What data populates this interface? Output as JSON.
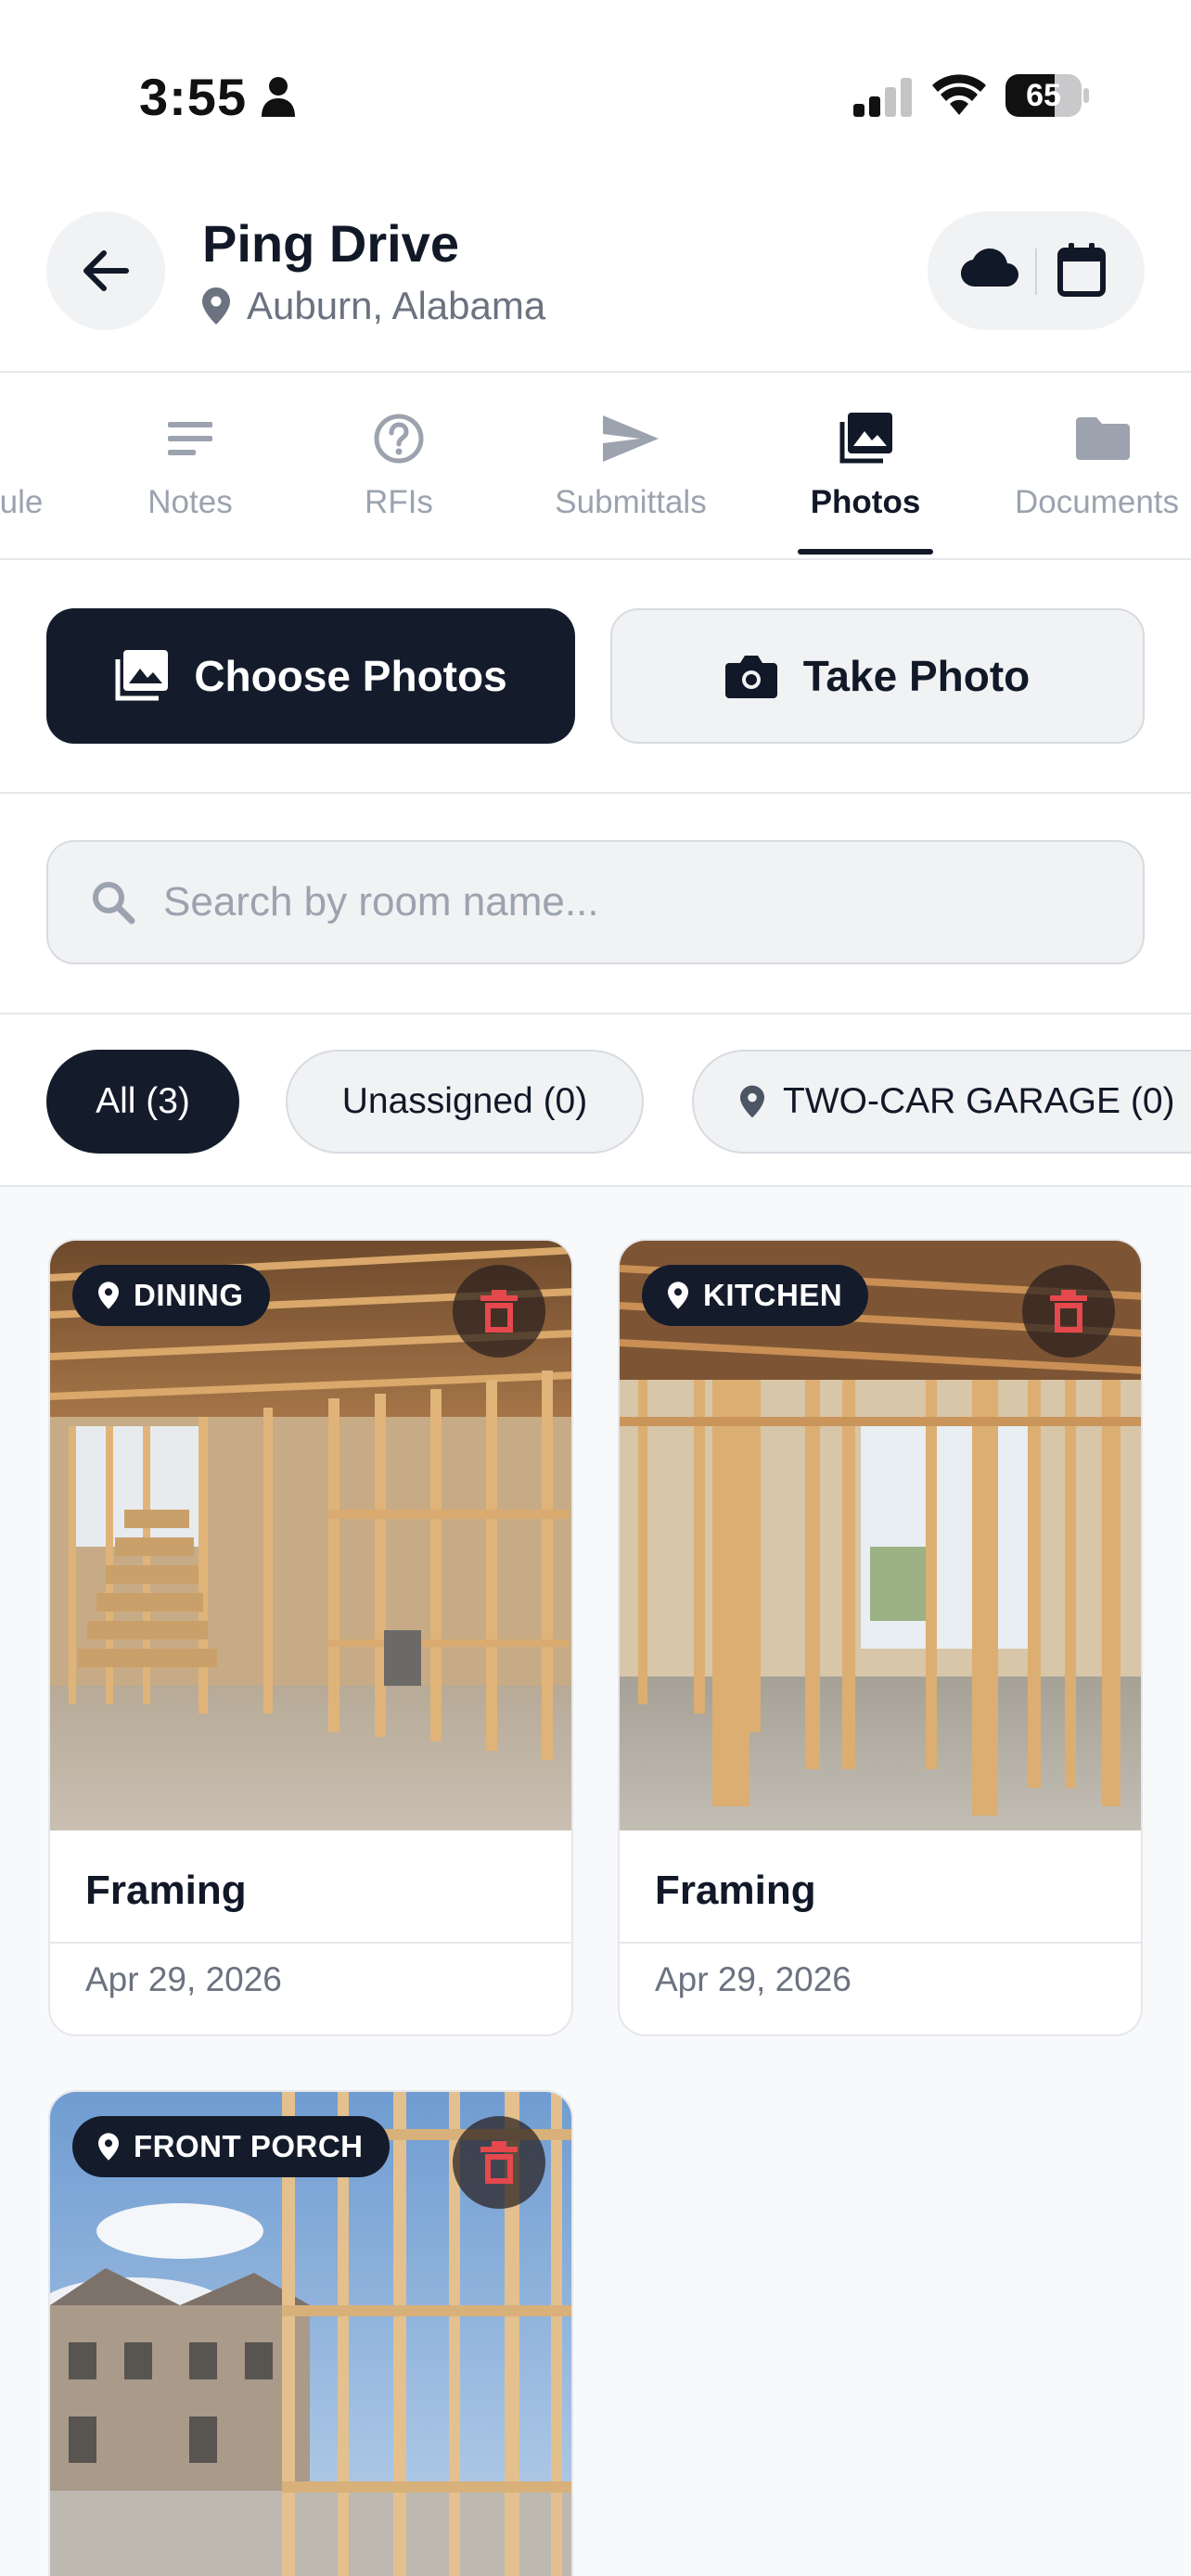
{
  "status_bar": {
    "time": "3:55",
    "battery": "65",
    "battery_level": 0.65
  },
  "header": {
    "title": "Ping Drive",
    "location": "Auburn, Alabama"
  },
  "tabs": [
    {
      "label": "ule",
      "icon": "schedule-icon"
    },
    {
      "label": "Notes",
      "icon": "notes-icon"
    },
    {
      "label": "RFIs",
      "icon": "help-circle-icon"
    },
    {
      "label": "Submittals",
      "icon": "send-icon"
    },
    {
      "label": "Photos",
      "icon": "photos-icon",
      "active": true
    },
    {
      "label": "Documents",
      "icon": "folder-icon"
    }
  ],
  "actions": {
    "choose_label": "Choose Photos",
    "take_label": "Take Photo"
  },
  "search": {
    "placeholder": "Search by room name..."
  },
  "filters": [
    {
      "label": "All (3)",
      "selected": true
    },
    {
      "label": "Unassigned (0)"
    },
    {
      "label": "TWO-CAR GARAGE (0)",
      "icon": "location-pin-icon"
    }
  ],
  "photos": [
    {
      "room": "DINING",
      "title": "Framing",
      "date": "Apr 29, 2026"
    },
    {
      "room": "KITCHEN",
      "title": "Framing",
      "date": "Apr 29, 2026"
    },
    {
      "room": "FRONT PORCH"
    }
  ],
  "colors": {
    "primary": "#141c2c",
    "muted": "#9ca3af",
    "delete": "#e5484d",
    "surface": "#f1f2f4"
  }
}
